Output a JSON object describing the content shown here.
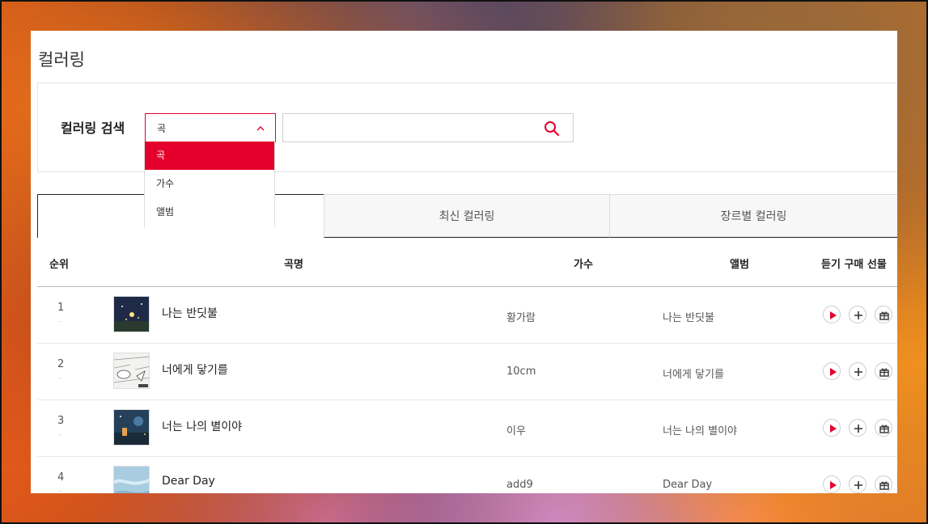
{
  "page": {
    "title": "컬러링"
  },
  "search": {
    "label": "컬러링 검색",
    "selected": "곡",
    "options": [
      "곡",
      "가수",
      "앨범"
    ],
    "placeholder": ""
  },
  "tabs": [
    "",
    "최신 컬러링",
    "장르별 컬러링"
  ],
  "table": {
    "headers": {
      "rank": "순위",
      "song": "곡명",
      "artist": "가수",
      "album": "앨범",
      "actions": "듣기 구매 선물"
    },
    "rows": [
      {
        "rank": "1",
        "change": "-",
        "song": "나는 반딧불",
        "artist": "황가람",
        "album": "나는 반딧불"
      },
      {
        "rank": "2",
        "change": "-",
        "song": "너에게 닿기를",
        "artist": "10cm",
        "album": "너에게 닿기를"
      },
      {
        "rank": "3",
        "change": "-",
        "song": "너는 나의 별이야",
        "artist": "이우",
        "album": "너는 나의 별이야"
      },
      {
        "rank": "4",
        "change": "-",
        "song": "Dear Day",
        "artist": "add9",
        "album": "Dear Day"
      }
    ]
  },
  "colors": {
    "accent": "#e4002b"
  }
}
